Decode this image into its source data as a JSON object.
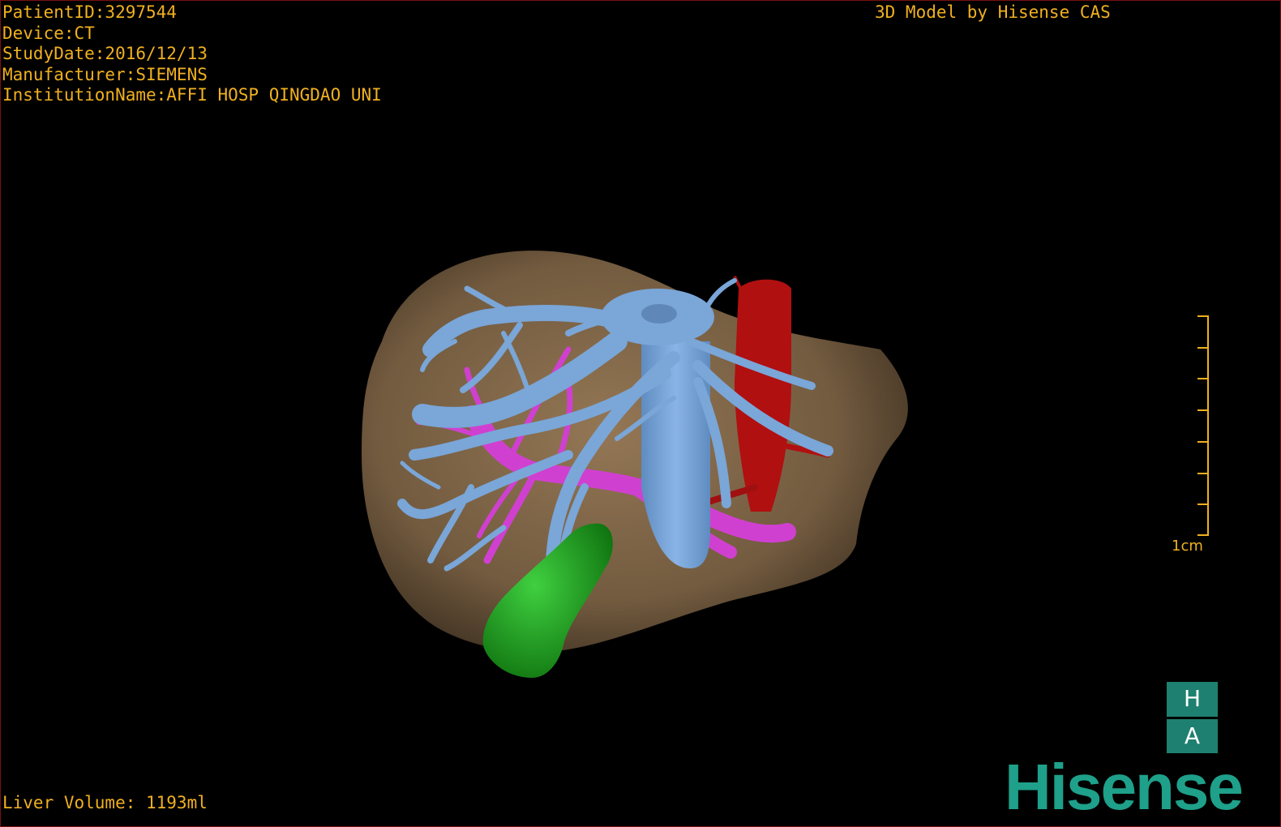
{
  "info": {
    "patient_id": "PatientID:3297544",
    "device": "Device:CT",
    "study_date": "StudyDate:2016/12/13",
    "manufacturer": "Manufacturer:SIEMENS",
    "institution": "InstitutionName:AFFI HOSP QINGDAO UNI"
  },
  "title": "3D Model by Hisense CAS",
  "liver_volume": "Liver Volume: 1193ml",
  "scale": {
    "label": "1cm"
  },
  "logo": {
    "top": "H",
    "bottom": "A",
    "brand": "Hisense"
  },
  "colors": {
    "text": "#f0b020",
    "liver": "#8a6e4e",
    "hepatic_vein": "#7aa6d8",
    "portal_vein": "#d040d0",
    "ivc_aorta": "#b01010",
    "gallbladder": "#20a020",
    "brand": "#1ea08a"
  }
}
